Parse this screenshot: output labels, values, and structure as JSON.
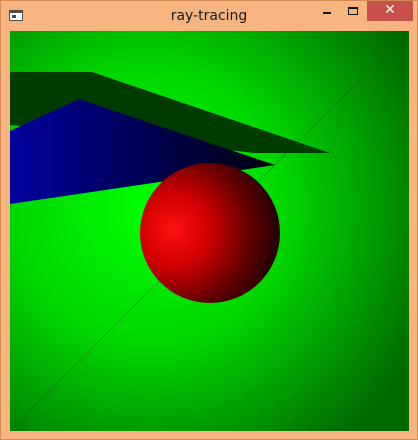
{
  "window": {
    "title": "ray-tracing",
    "close_glyph": "✕",
    "icons": {
      "app": "window-app-icon",
      "minimize": "minimize-icon",
      "maximize": "maximize-icon",
      "close": "close-icon"
    }
  },
  "scene": {
    "description_visible": false,
    "background_color": "#00e000",
    "floor_color": "#003a00",
    "wall_color": "#000090",
    "sphere_color": "#ff0000"
  }
}
